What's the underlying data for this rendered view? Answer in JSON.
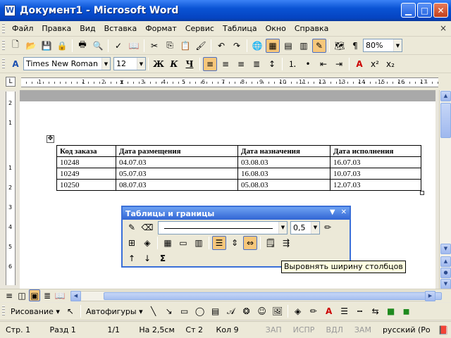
{
  "window": {
    "title": "Документ1 - Microsoft Word",
    "app_icon": "W",
    "controls": [
      "minimize-icon",
      "maximize-icon",
      "close-icon"
    ]
  },
  "menu": {
    "items": [
      "Файл",
      "Правка",
      "Вид",
      "Вставка",
      "Формат",
      "Сервис",
      "Таблица",
      "Окно",
      "Справка"
    ],
    "right_icons": [
      "×"
    ]
  },
  "toolbar_standard": {
    "zoom": "80%"
  },
  "toolbar_format": {
    "style_icon": "A",
    "font_name": "Times New Roman",
    "font_size": "12",
    "bold": "Ж",
    "italic": "К",
    "underline": "Ч"
  },
  "ruler": {
    "corner": "L",
    "h_numbers": [
      "1",
      "1",
      "2",
      "3",
      "4",
      "5",
      "6",
      "7",
      "8",
      "9",
      "10",
      "11",
      "12",
      "13",
      "14",
      "15",
      "16",
      "17"
    ],
    "v_numbers": [
      "2",
      "1",
      "1",
      "2",
      "3",
      "4",
      "5",
      "6"
    ]
  },
  "document": {
    "table": {
      "headers": [
        "Код заказа",
        "Дата размещения",
        "Дата назначения",
        "Дата исполнения"
      ],
      "rows": [
        [
          "10248",
          "04.07.03",
          "03.08.03",
          "16.07.03"
        ],
        [
          "10249",
          "05.07.03",
          "16.08.03",
          "10.07.03"
        ],
        [
          "10250",
          "08.07.03",
          "05.08.03",
          "12.07.03"
        ]
      ]
    }
  },
  "tables_borders_toolbar": {
    "title": "Таблицы и границы",
    "line_weight": "0,5",
    "sum_icon": "Σ"
  },
  "tooltip": "Выровнять ширину столбцов",
  "drawing_toolbar": {
    "drawing_label": "Рисование",
    "autoshapes_label": "Автофигуры"
  },
  "status": {
    "page": "Стр. 1",
    "section": "Разд 1",
    "page_of": "1/1",
    "at": "На 2,5см",
    "line": "Ст 2",
    "col": "Кол 9",
    "rec": "ЗАП",
    "trk": "ИСПР",
    "ext": "ВДЛ",
    "ovr": "ЗАМ",
    "language": "русский (Ро"
  }
}
